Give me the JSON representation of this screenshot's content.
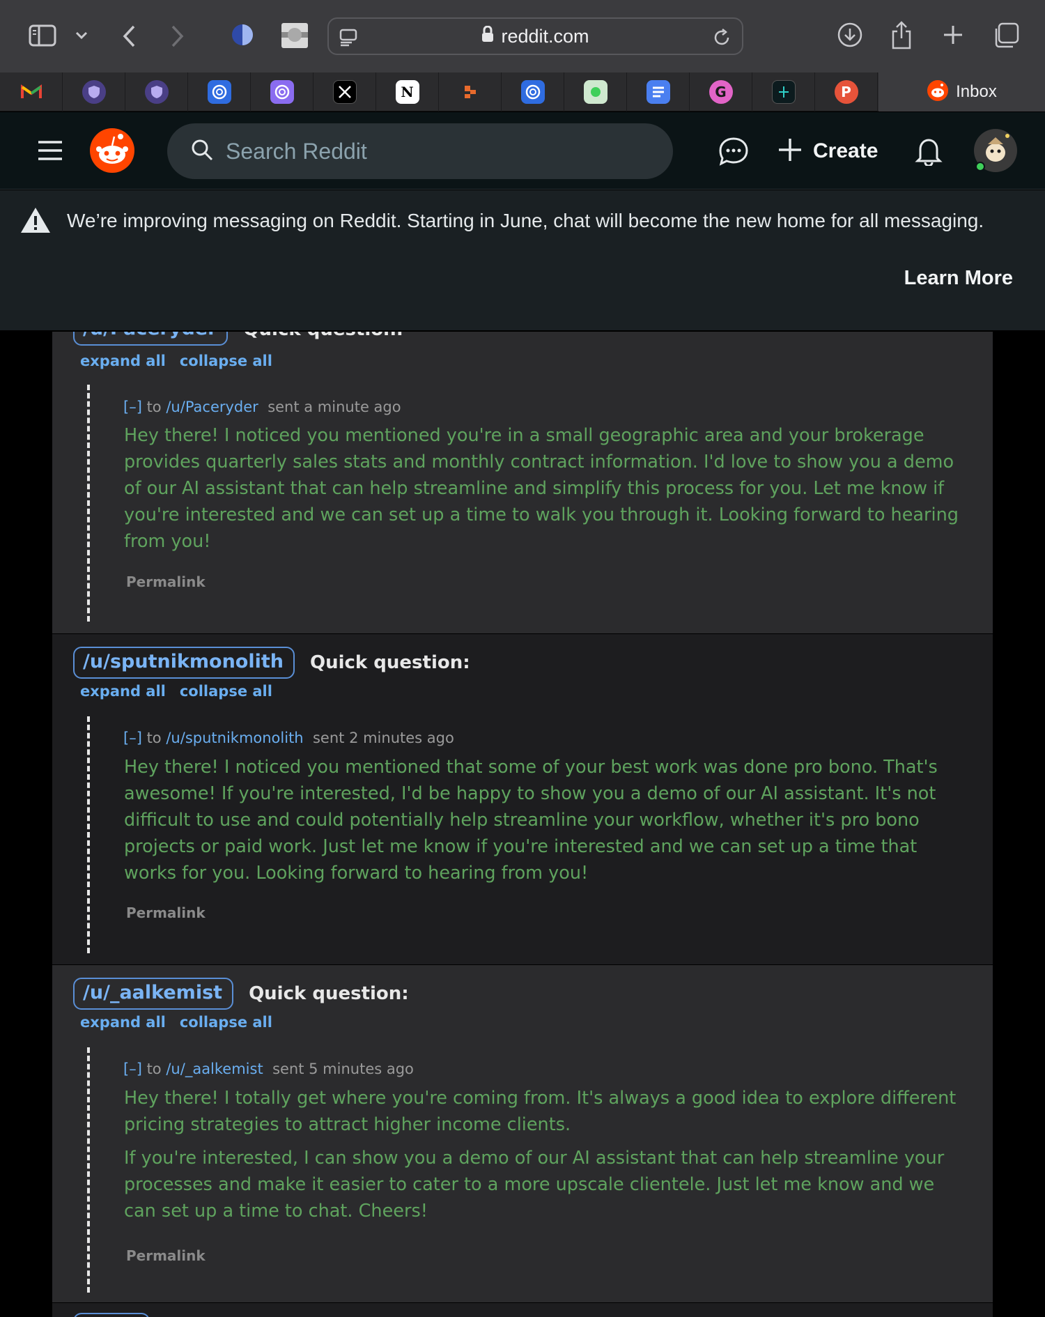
{
  "browser": {
    "url": "reddit.com",
    "tabs": [
      {
        "icon": "gmail-icon",
        "letter": "M",
        "color": "#ffffff"
      },
      {
        "icon": "shield-extension-icon",
        "letter": "",
        "color": "#8e7fd6"
      },
      {
        "icon": "shield-extension-icon",
        "letter": "",
        "color": "#8e7fd6"
      },
      {
        "icon": "chatgpt-icon",
        "letter": "",
        "color": "#2f6ce0"
      },
      {
        "icon": "chatgpt-icon",
        "letter": "",
        "color": "#8a6cf0"
      },
      {
        "icon": "x-icon",
        "letter": "X",
        "color": "#000000"
      },
      {
        "icon": "notion-icon",
        "letter": "N",
        "color": "#ffffff"
      },
      {
        "icon": "orange-blocks-icon",
        "letter": "",
        "color": "#e86a2c"
      },
      {
        "icon": "chatgpt-icon",
        "letter": "",
        "color": "#2f6ce0"
      },
      {
        "icon": "green-dot-icon",
        "letter": "",
        "color": "#cfe8cf"
      },
      {
        "icon": "docs-icon",
        "letter": "",
        "color": "#4a7ff0"
      },
      {
        "icon": "grammarly-icon",
        "letter": "G",
        "color": "#e264c7"
      },
      {
        "icon": "dark-app-icon",
        "letter": "",
        "color": "#0c1b1e"
      },
      {
        "icon": "producthunt-icon",
        "letter": "P",
        "color": "#e6533a"
      }
    ],
    "active_tab": {
      "label": "Inbox"
    }
  },
  "header": {
    "search_placeholder": "Search Reddit",
    "create_label": "Create"
  },
  "banner": {
    "text": "We’re improving messaging on Reddit. Starting in June, chat will become the new home for all messaging.",
    "learn_more": "Learn More"
  },
  "threads": [
    {
      "user": "/u/Paceryder",
      "subject": "Quick question:",
      "expand_all": "expand all",
      "collapse_all": "collapse all",
      "collapse_marker": "[–]",
      "to_word": "to",
      "recipient": "/u/Paceryder",
      "time": "sent a minute ago",
      "body": [
        "Hey there! I noticed you mentioned you're in a small geographic area and your brokerage provides quarterly sales stats and monthly contract information. I'd love to show you a demo of our AI assistant that can help streamline and simplify this process for you. Let me know if you're interested and we can set up a time to walk you through it. Looking forward to hearing from you!"
      ],
      "permalink": "Permalink"
    },
    {
      "user": "/u/sputnikmonolith",
      "subject": "Quick question:",
      "expand_all": "expand all",
      "collapse_all": "collapse all",
      "collapse_marker": "[–]",
      "to_word": "to",
      "recipient": "/u/sputnikmonolith",
      "time": "sent 2 minutes ago",
      "body": [
        "Hey there! I noticed you mentioned that some of your best work was done pro bono. That's awesome! If you're interested, I'd be happy to show you a demo of our AI assistant. It's not difficult to use and could potentially help streamline your workflow, whether it's pro bono projects or paid work. Just let me know if you're interested and we can set up a time that works for you. Looking forward to hearing from you!"
      ],
      "permalink": "Permalink"
    },
    {
      "user": "/u/_aalkemist",
      "subject": "Quick question:",
      "expand_all": "expand all",
      "collapse_all": "collapse all",
      "collapse_marker": "[–]",
      "to_word": "to",
      "recipient": "/u/_aalkemist",
      "time": "sent 5 minutes ago",
      "body": [
        "Hey there! I totally get where you're coming from. It's always a good idea to explore different pricing strategies to attract higher income clients.",
        "If you're interested, I can show you a demo of our AI assistant that can help streamline your processes and make it easier to cater to a more upscale clientele. Just let me know and we can set up a time to chat. Cheers!"
      ],
      "permalink": "Permalink"
    }
  ]
}
